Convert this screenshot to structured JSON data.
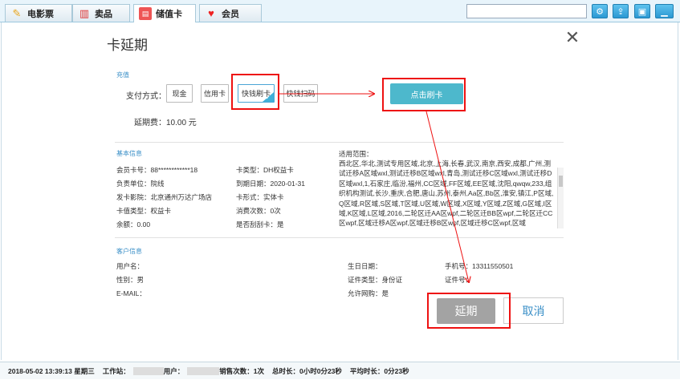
{
  "tabs": [
    {
      "label": "电影票",
      "icon": "ticket-icon"
    },
    {
      "label": "卖品",
      "icon": "popcorn-icon"
    },
    {
      "label": "储值卡",
      "icon": "card-icon"
    },
    {
      "label": "会员",
      "icon": "heart-icon"
    }
  ],
  "toolbar": {
    "search_placeholder": "",
    "icons": [
      "settings-icon",
      "upload-icon",
      "window-icon",
      "minimize-icon"
    ]
  },
  "dialog": {
    "title": "卡延期",
    "close": "✕",
    "recharge_section": "充值",
    "pay_label": "支付方式：",
    "pay_methods": [
      "现金",
      "信用卡",
      "快钱刷卡",
      "快钱扫码"
    ],
    "selected_pay_method": "快钱刷卡",
    "swipe_button": "点击刷卡",
    "fee_label": "延期费：10.00 元",
    "basic_section": "基本信息",
    "basic": {
      "card_no": "会员卡号：88************18",
      "unit": "负责单位：院线",
      "cinema": "发卡影院：北京通州万达广场店",
      "value_type": "卡值类型：权益卡",
      "balance": "余额：0.00",
      "card_type": "卡类型：DH权益卡",
      "expire": "到期日期：2020-01-31",
      "form": "卡形式：实体卡",
      "consume": "消费次数：0次",
      "scratch": "是否刮刮卡：是",
      "scope_label": "适用范围：",
      "scope_text": "西北区,华北,测试专用区域,北京,上海,长春,武汉,南京,西安,成都,广州,测试迁移A区域wxl,测试迁移B区域wxl,青岛,测试迁移C区域wxl,测试迁移D区域wxl,1,石家庄,临汾,福州,CC区域,FF区域,EE区域,沈阳,qwqw,233,组织机构测试,长沙,重庆,合肥,唐山,苏州,泰州,Aa区,Bb区,淮安,镇江,P区域,Q区域,R区域,S区域,T区域,U区域,W区域,X区域,Y区域,Z区域,G区域,I区域,K区域,L区域,2016,二轮区迁AA区wpf,二轮区迁BB区wpf,二轮区迁CC区wpf,区域迁移A区wpf,区域迁移B区wpf,区域迁移C区wpf,区域"
    },
    "customer_section": "客户信息",
    "customer": {
      "name": "用户名：",
      "gender": "性别：男",
      "email": "E-MAIL：",
      "birthday": "生日日期：",
      "id_type": "证件类型：身份证",
      "allow_net": "允许网购：是",
      "phone": "手机号：13311550501",
      "id_no": "证件号："
    },
    "extend_button": "延期",
    "cancel_button": "取消"
  },
  "status": {
    "datetime": "2018-05-02 13:39:13 星期三",
    "workstation": "工作站：",
    "user": "用户：",
    "sales": "销售次数：1次",
    "total": "总时长：0小时0分23秒",
    "avg": "平均时长：0分23秒"
  },
  "colors": {
    "accent": "#3a8fc7",
    "button": "#4db8cc",
    "highlight": "#ee1111"
  }
}
